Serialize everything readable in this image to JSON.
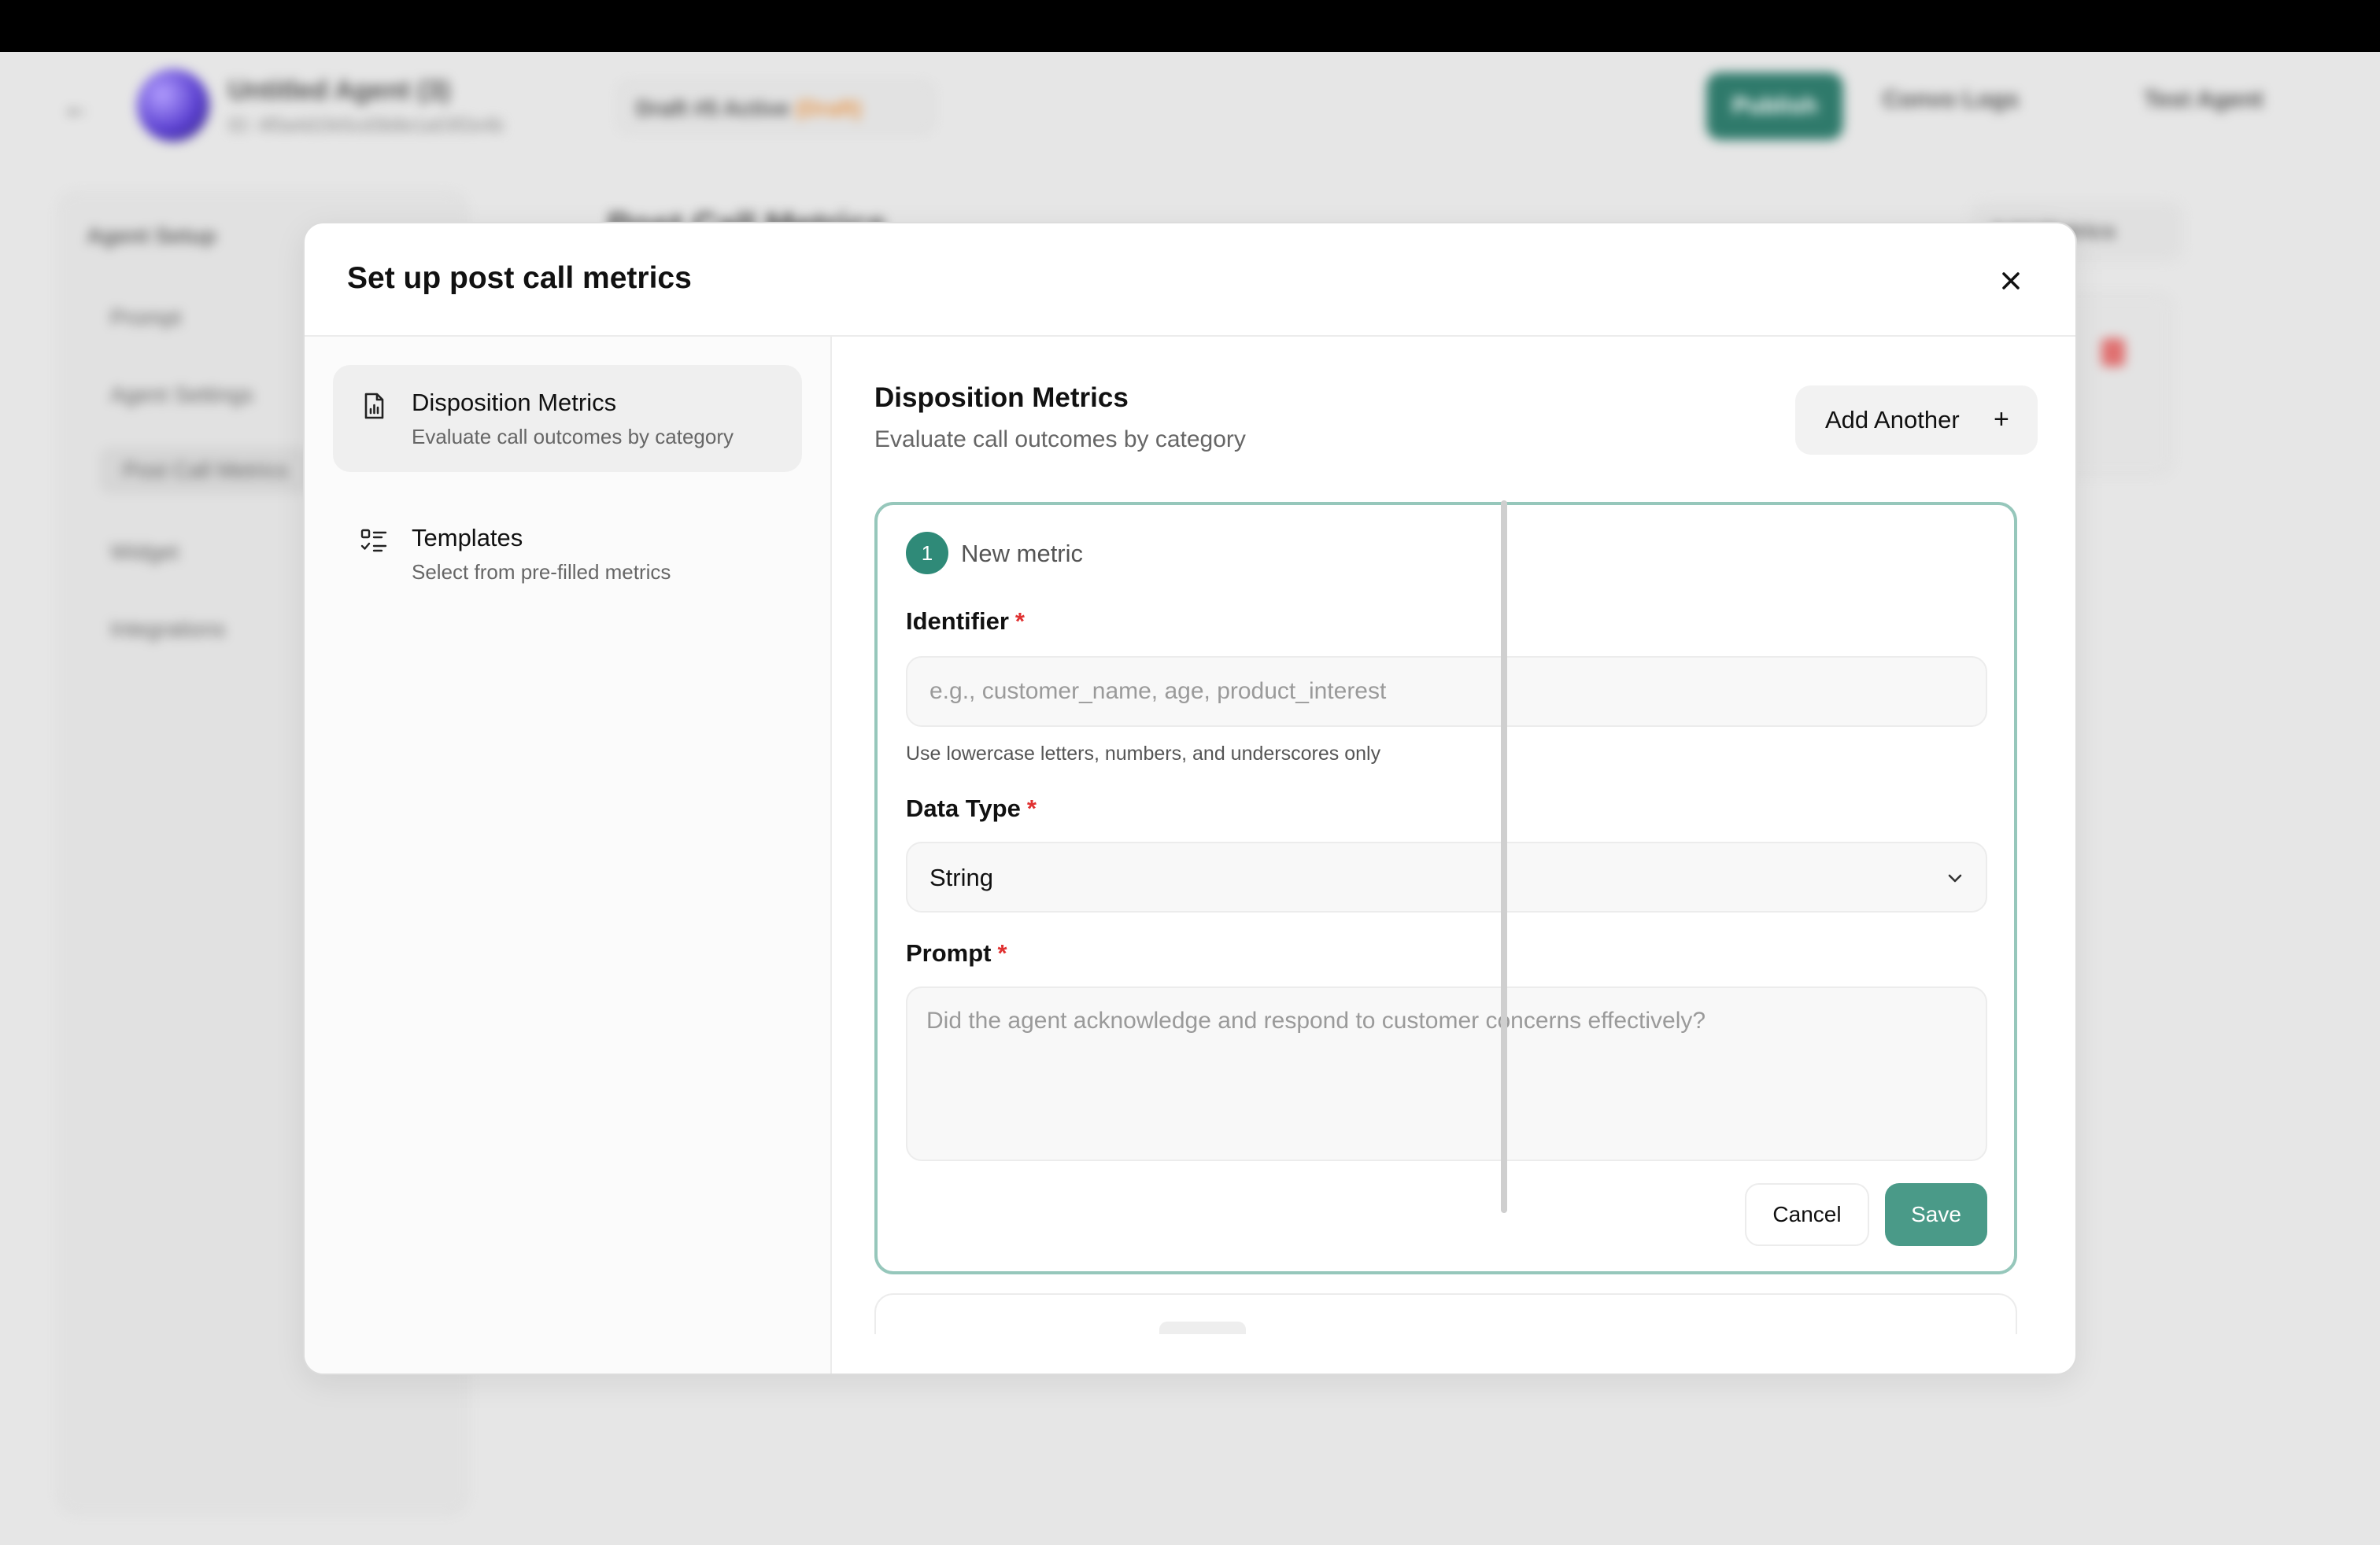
{
  "background": {
    "agent_name": "Untitled Agent (3)",
    "agent_id": "ID: 4f0a4d1fe5cd3b8e1a03f2e4b",
    "draft_label": "Draft #5 Active",
    "draft_status": "(Draft)",
    "publish_label": "Publish",
    "logs_label": "Convo Logs",
    "test_label": "Test Agent",
    "sidebar_title": "Agent Setup",
    "nav": [
      "Prompt",
      "Agent Settings",
      "Post Call Metrics",
      "Widget",
      "Integrations"
    ],
    "page_title": "Post Call Metrics",
    "right_button": "Add Metrics"
  },
  "modal": {
    "title": "Set up post call metrics",
    "nav": [
      {
        "title": "Disposition Metrics",
        "subtitle": "Evaluate call outcomes by category",
        "icon": "file-chart-icon"
      },
      {
        "title": "Templates",
        "subtitle": "Select from pre-filled metrics",
        "icon": "checklist-icon"
      }
    ],
    "section": {
      "title": "Disposition Metrics",
      "subtitle": "Evaluate call outcomes by category",
      "add_button": "Add Another",
      "add_icon": "+"
    },
    "metric": {
      "number": "1",
      "label": "New metric",
      "identifier_label": "Identifier",
      "identifier_value": "",
      "identifier_placeholder": "e.g., customer_name, age, product_interest",
      "identifier_hint": "Use lowercase letters, numbers, and underscores only",
      "data_type_label": "Data Type",
      "data_type_value": "String",
      "prompt_label": "Prompt",
      "prompt_value": "",
      "prompt_placeholder": "Did the agent acknowledge and respond to customer concerns effectively?",
      "required_mark": "*",
      "cancel_label": "Cancel",
      "save_label": "Save"
    }
  },
  "colors": {
    "accent": "#2f8a78",
    "save_button": "#4a9a88",
    "card_border": "#96c7bb",
    "required": "#e03131"
  }
}
